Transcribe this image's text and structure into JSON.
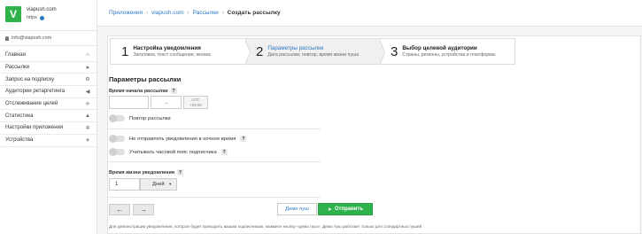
{
  "brand": {
    "name": "viapush.com",
    "protocol": "https",
    "logo_letter": "V",
    "accent": "#2fb24c"
  },
  "user": {
    "email": "info@viapush.com"
  },
  "menu": [
    {
      "label": "Главная",
      "icon": "home-icon",
      "glyph": "⌂"
    },
    {
      "label": "Рассылки",
      "icon": "paper-plane-icon",
      "glyph": "➤"
    },
    {
      "label": "Запрос на подписку",
      "icon": "bicycle-icon",
      "glyph": "⚙"
    },
    {
      "label": "Аудитории ретаргетинга",
      "icon": "bullhorn-icon",
      "glyph": "◀"
    },
    {
      "label": "Отслеживание целей",
      "icon": "crosshair-icon",
      "glyph": "✛"
    },
    {
      "label": "Статистика",
      "icon": "chart-icon",
      "glyph": "▲"
    },
    {
      "label": "Настройки приложения",
      "icon": "gear-icon",
      "glyph": "✲"
    },
    {
      "label": "Устройства",
      "icon": "rocket-icon",
      "glyph": "✈"
    }
  ],
  "breadcrumb": {
    "items": [
      "Приложения",
      "viapush.com",
      "Рассылки"
    ],
    "current": "Создать рассылку"
  },
  "steps": [
    {
      "num": "1",
      "title": "Настройка уведомления",
      "sub": "Заголовок, текст сообщения, иконка"
    },
    {
      "num": "2",
      "title": "Параметры рассылки",
      "sub": "Дата рассылки, повтор, время жизни пуша"
    },
    {
      "num": "3",
      "title": "Выбор целевой аудитории",
      "sub": "Страны, регионы, устройства и платформы"
    }
  ],
  "form": {
    "title": "Параметры рассылки",
    "start_time_label": "Время начала рассылки",
    "utc_line1": "UTC",
    "utc_line2": "+03:00",
    "repeat_label": "Повтор рассылки",
    "no_night_label": "Не отправлять уведомления в ночное время",
    "timezone_label": "Учитывать часовой пояс подписчика",
    "lifetime_label": "Время жизни уведомления",
    "lifetime_value": "1",
    "lifetime_unit": "Дней",
    "q": "?"
  },
  "buttons": {
    "prev": "←",
    "next": "→",
    "demo": "Демо пуш",
    "send": "Отправить"
  },
  "note": "Для демонстрации уведомления, которое будет приходить вашим подписчикам, нажмите кнопку «демо пуш». Демо пуш работает только для стандартных пушей"
}
